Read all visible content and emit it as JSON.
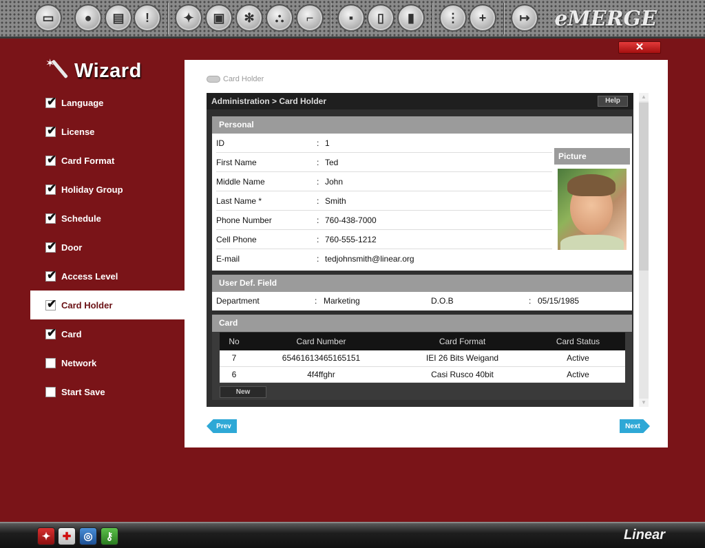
{
  "app": {
    "brand": "eMERGE",
    "footer_brand": "Linear"
  },
  "toolbar": {
    "buttons": [
      "monitor-icon",
      "user-icon",
      "id-card-icon",
      "alert-icon",
      "lightbulb-icon",
      "camera-icon",
      "gears-icon",
      "network-icon",
      "stairs-icon",
      "save-icon",
      "document-icon",
      "bar-chart-icon",
      "grid-icon",
      "add-user-icon",
      "exit-icon"
    ]
  },
  "close": {
    "label": "✕"
  },
  "wizard": {
    "title": "Wizard",
    "steps": [
      {
        "label": "Language",
        "checked": true
      },
      {
        "label": "License",
        "checked": true
      },
      {
        "label": "Card Format",
        "checked": true
      },
      {
        "label": "Holiday Group",
        "checked": true
      },
      {
        "label": "Schedule",
        "checked": true
      },
      {
        "label": "Door",
        "checked": true
      },
      {
        "label": "Access Level",
        "checked": true
      },
      {
        "label": "Card Holder",
        "checked": true,
        "active": true
      },
      {
        "label": "Card",
        "checked": true
      },
      {
        "label": "Network",
        "checked": false
      },
      {
        "label": "Start Save",
        "checked": false
      }
    ]
  },
  "page": {
    "breadcrumb_top": "Card Holder",
    "header": "Administration > Card Holder",
    "help_label": "Help",
    "personal": {
      "title": "Personal",
      "rows": [
        {
          "label": "ID",
          "value": "1"
        },
        {
          "label": "First Name",
          "value": "Ted"
        },
        {
          "label": "Middle Name",
          "value": "John"
        },
        {
          "label": "Last Name *",
          "value": "Smith"
        },
        {
          "label": "Phone Number",
          "value": "760-438-7000"
        },
        {
          "label": "Cell Phone",
          "value": "760-555-1212"
        },
        {
          "label": "E-mail",
          "value": "tedjohnsmith@linear.org"
        }
      ],
      "picture_label": "Picture"
    },
    "udf": {
      "title": "User Def. Field",
      "department_label": "Department",
      "department_value": "Marketing",
      "dob_label": "D.O.B",
      "dob_value": "05/15/1985"
    },
    "card": {
      "title": "Card",
      "columns": [
        "No",
        "Card Number",
        "Card Format",
        "Card Status"
      ],
      "rows": [
        [
          "7",
          "65461613465165151",
          "IEI 26 Bits Weigand",
          "Active"
        ],
        [
          "6",
          "4f4ffghr",
          "Casi Rusco 40bit",
          "Active"
        ]
      ],
      "new_label": "New"
    },
    "prev_label": "Prev",
    "next_label": "Next"
  },
  "colors": {
    "background": "#7a1418",
    "accent": "#2ea8d6",
    "close": "#c41a1a"
  }
}
